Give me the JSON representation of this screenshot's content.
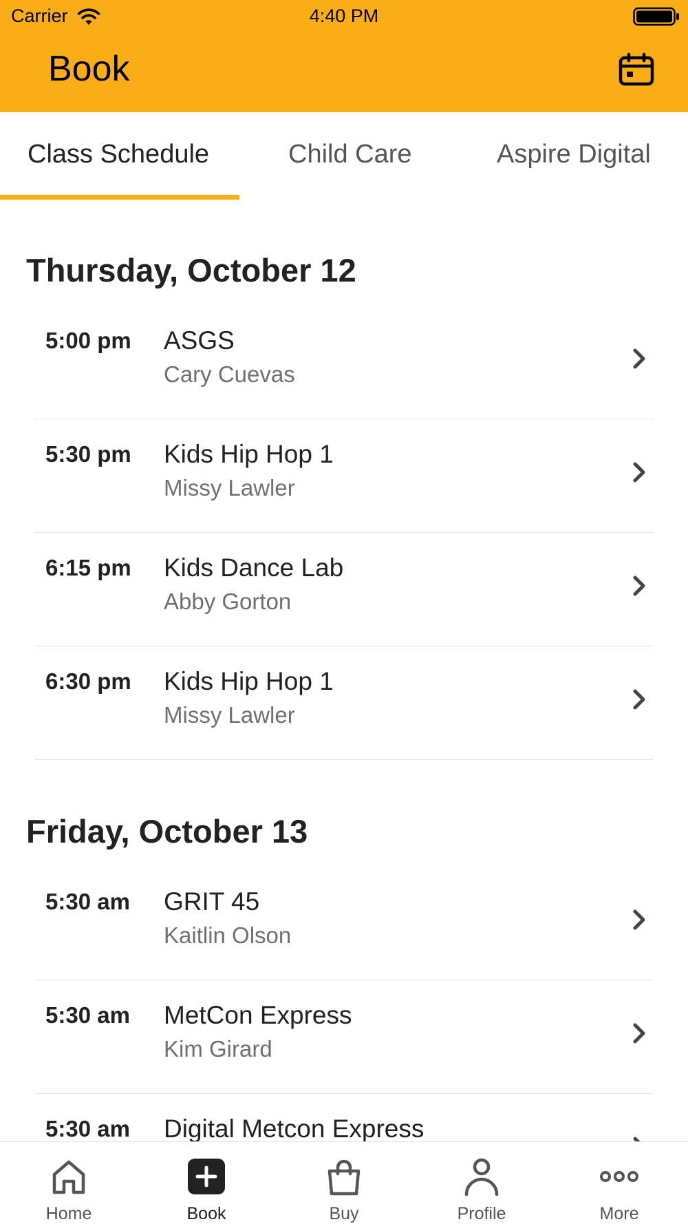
{
  "status_bar": {
    "carrier": "Carrier",
    "time": "4:40 PM"
  },
  "header": {
    "title": "Book",
    "accent_color": "#FBAD18"
  },
  "tabs": [
    {
      "label": "Class Schedule",
      "active": true
    },
    {
      "label": "Child Care",
      "active": false
    },
    {
      "label": "Aspire Digital",
      "active": false
    }
  ],
  "sections": [
    {
      "date": "Thursday, October 12",
      "classes": [
        {
          "time": "5:00 pm",
          "name": "ASGS",
          "instructor": "Cary Cuevas"
        },
        {
          "time": "5:30 pm",
          "name": "Kids Hip Hop 1",
          "instructor": "Missy Lawler"
        },
        {
          "time": "6:15 pm",
          "name": "Kids Dance Lab",
          "instructor": "Abby Gorton"
        },
        {
          "time": "6:30 pm",
          "name": "Kids Hip Hop 1",
          "instructor": "Missy Lawler"
        }
      ]
    },
    {
      "date": "Friday, October 13",
      "classes": [
        {
          "time": "5:30 am",
          "name": "GRIT 45",
          "instructor": "Kaitlin Olson"
        },
        {
          "time": "5:30 am",
          "name": "MetCon Express",
          "instructor": "Kim Girard"
        },
        {
          "time": "5:30 am",
          "name": "Digital Metcon Express",
          "instructor": ""
        }
      ]
    }
  ],
  "tabbar": [
    {
      "label": "Home",
      "icon": "home-icon",
      "active": false
    },
    {
      "label": "Book",
      "icon": "plus-icon",
      "active": true
    },
    {
      "label": "Buy",
      "icon": "bag-icon",
      "active": false
    },
    {
      "label": "Profile",
      "icon": "person-icon",
      "active": false
    },
    {
      "label": "More",
      "icon": "more-icon",
      "active": false
    }
  ]
}
